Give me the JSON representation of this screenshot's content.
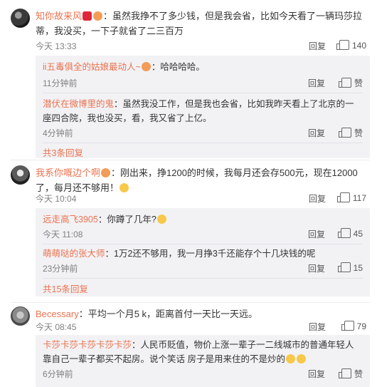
{
  "comments": [
    {
      "username": "知你故来风",
      "text": "：虽然我挣不了多少钱，但是我会省，比如今天看了一辆玛莎拉蒂，我没买，一下子就省了二三百万",
      "time": "今天 13:33",
      "reply_label": "回复",
      "likes": "140",
      "replies": [
        {
          "username": "ii五毒俱全的姑娘最动人~",
          "text": "：哈哈哈哈。",
          "time": "11分钟前",
          "reply_label": "回复",
          "like_label": "赞"
        },
        {
          "username": "潜伏在微博里的鬼",
          "text": "：虽然我没工作，但是我也会省，比如我昨天看上了北京的一座四合院，我也没买，看，我又省了上亿。",
          "time": "4分钟前",
          "reply_label": "回复",
          "like_label": "赞"
        }
      ],
      "more_replies": "共3条回复"
    },
    {
      "username": "我系你嘅边个啊",
      "text": "：刚出来，挣1200的时候，我每月还会存500元，现在12000了，每月还不够用！",
      "time": "今天 10:04",
      "reply_label": "回复",
      "likes": "117",
      "replies": [
        {
          "username": "远走高飞3905",
          "text": "：你蹲了几年?",
          "time": "今天 11:08",
          "reply_label": "回复",
          "like_label": "45"
        },
        {
          "username": "萌萌哒的张大师",
          "text": "：1万2还不够用，我一月挣3千还能存个十几块钱的呢",
          "time": "23分钟前",
          "reply_label": "回复",
          "like_label": "15"
        }
      ],
      "more_replies": "共15条回复"
    },
    {
      "username": "Becessary",
      "text": "：平均一个月5 k，距离首付一天比一天远。",
      "time": "今天 08:45",
      "reply_label": "回复",
      "likes": "79",
      "replies": [
        {
          "username": "卡莎卡莎卡莎卡莎卡莎",
          "text": "：人民币贬值，物价上涨一辈子一二线城市的普通年轻人靠自己一辈子都买不起房。说个笑话 房子是用来住的不是炒的",
          "time": "6分钟前",
          "reply_label": "回复",
          "like_label": "赞"
        }
      ]
    }
  ]
}
